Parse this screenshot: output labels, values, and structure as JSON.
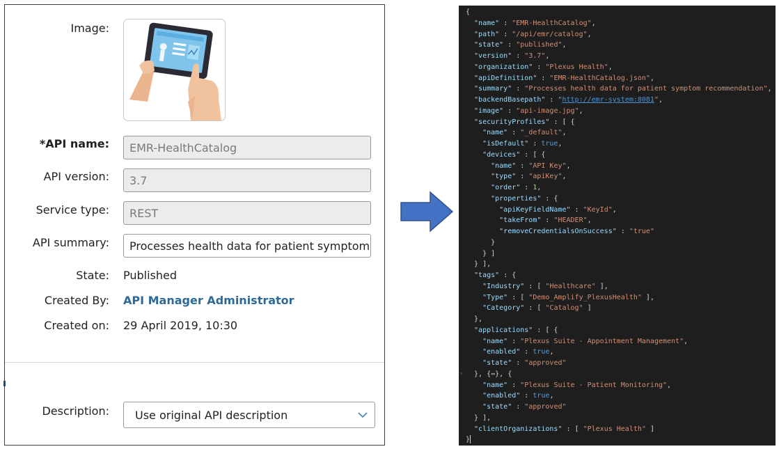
{
  "form": {
    "image_label": "Image:",
    "api_name_label": "*API name:",
    "api_name_value": "EMR-HealthCatalog",
    "api_version_label": "API version:",
    "api_version_value": "3.7",
    "service_type_label": "Service type:",
    "service_type_value": "REST",
    "api_summary_label": "API summary:",
    "api_summary_value": "Processes health data for patient symptom recommendation",
    "state_label": "State:",
    "state_value": "Published",
    "created_by_label": "Created By:",
    "created_by_value": "API Manager Administrator",
    "created_on_label": "Created on:",
    "created_on_value": "29 April 2019, 10:30",
    "description_label": "Description:",
    "description_value": "Use original API description"
  },
  "colors": {
    "link": "#2e6a97",
    "arrow": "#4472c4",
    "code_bg": "#1e1e1e",
    "json_key": "#9cdcfe",
    "json_string": "#ce9178",
    "json_number": "#b5cea8",
    "json_bool": "#569cd6"
  },
  "json": {
    "name": "EMR-HealthCatalog",
    "path": "/api/emr/catalog",
    "state": "published",
    "version": "3.7",
    "organization": "Plexus Health",
    "apiDefinition": "EMR-HealthCatalog.json",
    "summary": "Processes health data for patient symptom recommendation",
    "backendBasepath": "http://emr-system:8081",
    "image": "api-image.jpg",
    "sp_name": "_default",
    "sp_isDefault": "true",
    "dev_name": "API Key",
    "dev_type": "apiKey",
    "dev_order": "1",
    "apiKeyFieldName": "KeyId",
    "takeFrom": "HEADER",
    "removeCredentialsOnSuccess": "true",
    "tag_industry": "Healthcare",
    "tag_type": "Demo_Amplify_PlexusHealth",
    "tag_category": "Catalog",
    "app1_name": "Plexus Suite - Appointment Management",
    "app1_enabled": "true",
    "app1_state": "approved",
    "app2_name": "Plexus Suite - Patient Monitoring",
    "app2_enabled": "true",
    "app2_state": "approved",
    "clientOrganizations": "Plexus Health"
  }
}
